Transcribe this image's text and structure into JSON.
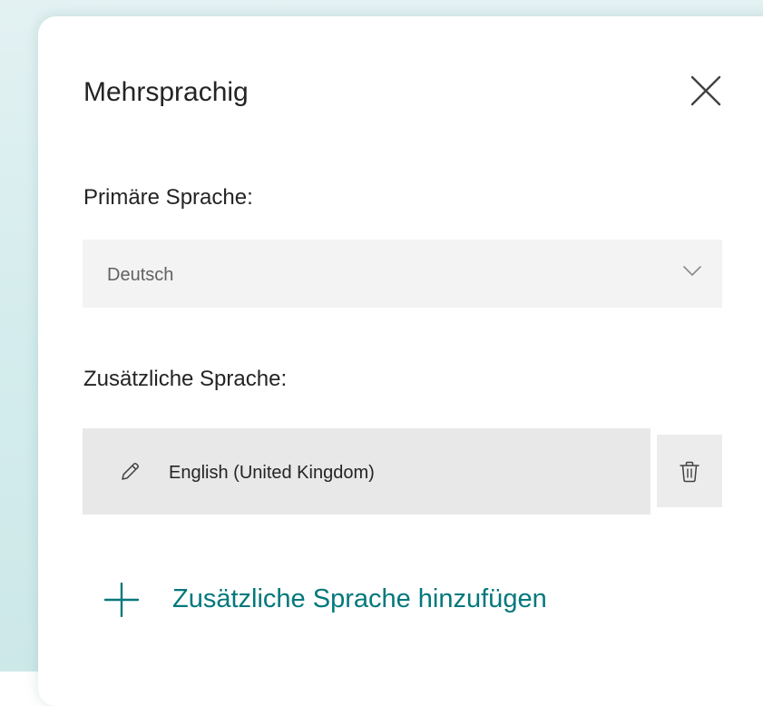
{
  "dialog": {
    "title": "Mehrsprachig",
    "close_icon": "close-icon"
  },
  "primary_language": {
    "label": "Primäre Sprache:",
    "selected": "Deutsch",
    "dropdown_icon": "chevron-down-icon"
  },
  "additional_languages": {
    "label": "Zusätzliche Sprache:",
    "items": [
      {
        "name": "English (United Kingdom)",
        "edit_icon": "pencil-icon",
        "delete_icon": "trash-icon"
      }
    ]
  },
  "add_language": {
    "label": "Zusätzliche Sprache hinzufügen",
    "icon": "plus-icon"
  },
  "colors": {
    "accent": "#03787c",
    "text": "#242424",
    "muted_text": "#616161",
    "field_background": "#f3f3f3",
    "row_background": "#e8e8e8",
    "backdrop": "#d4eced"
  }
}
